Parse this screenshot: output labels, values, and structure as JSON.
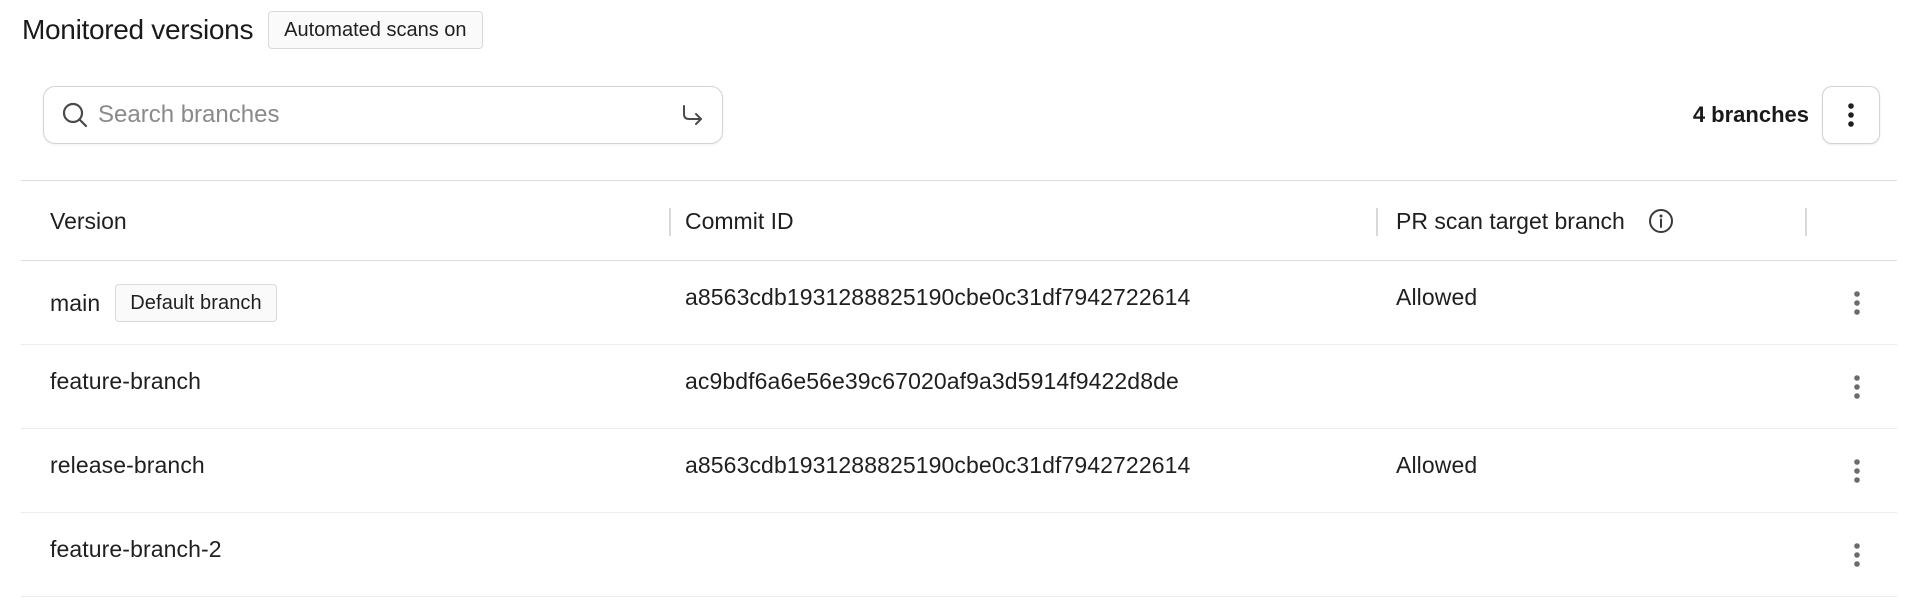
{
  "header": {
    "title": "Monitored versions",
    "scan_badge": "Automated scans on"
  },
  "search": {
    "placeholder": "Search branches",
    "value": ""
  },
  "toolbar": {
    "branch_count": "4 branches"
  },
  "table": {
    "columns": {
      "version": "Version",
      "commit": "Commit ID",
      "target": "PR scan target branch"
    },
    "rows": [
      {
        "version": "main",
        "badge": "Default branch",
        "commit": "a8563cdb1931288825190cbe0c31df7942722614",
        "target": "Allowed"
      },
      {
        "version": "feature-branch",
        "badge": "",
        "commit": "ac9bdf6a6e56e39c67020af9a3d5914f9422d8de",
        "target": ""
      },
      {
        "version": "release-branch",
        "badge": "",
        "commit": "a8563cdb1931288825190cbe0c31df7942722614",
        "target": "Allowed"
      },
      {
        "version": "feature-branch-2",
        "badge": "",
        "commit": "",
        "target": ""
      }
    ]
  },
  "icons": {
    "search": "search-icon",
    "enter": "enter-arrow-icon",
    "more": "kebab-menu-icon",
    "info": "info-icon"
  },
  "colors": {
    "text": "#1f1f1f",
    "border": "#d9d9d9",
    "icon": "#6b6b6b"
  }
}
